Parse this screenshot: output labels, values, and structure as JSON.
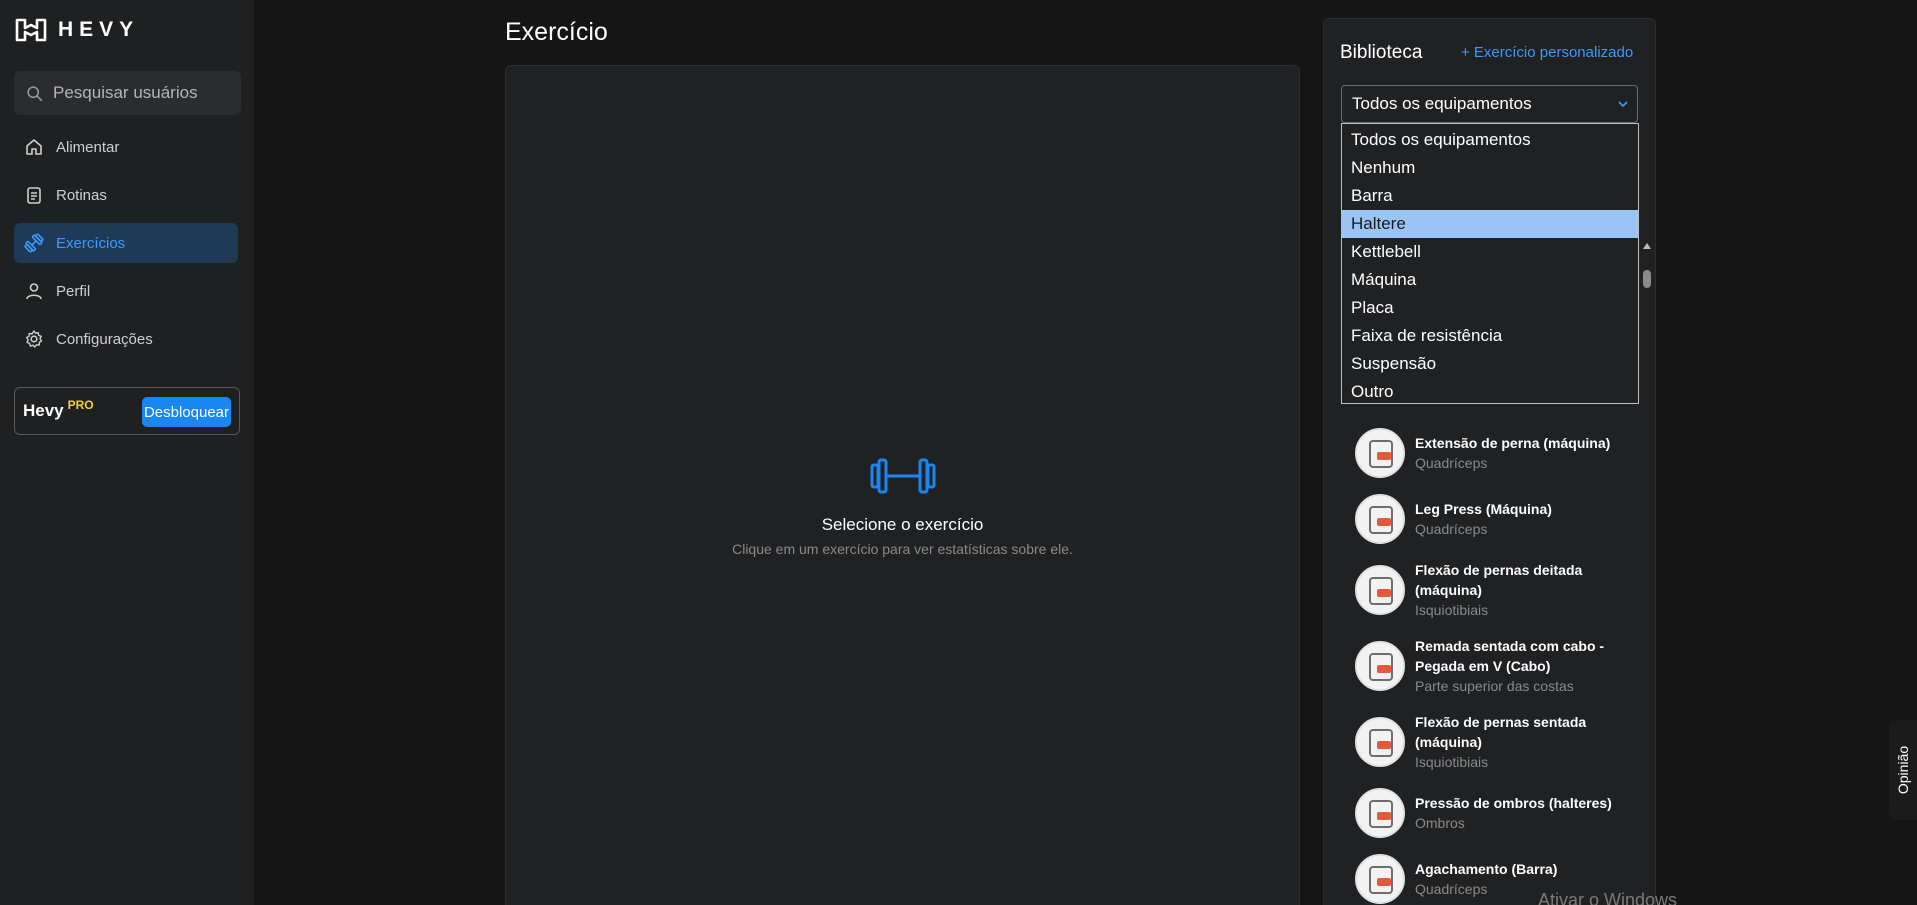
{
  "app": {
    "logo_text": "HEVY"
  },
  "search": {
    "placeholder": "Pesquisar usuários"
  },
  "nav": [
    {
      "label": "Alimentar",
      "icon": "home-icon"
    },
    {
      "label": "Rotinas",
      "icon": "clipboard-icon"
    },
    {
      "label": "Exercícios",
      "icon": "dumbbell-icon",
      "active": true
    },
    {
      "label": "Perfil",
      "icon": "user-icon"
    },
    {
      "label": "Configurações",
      "icon": "gear-icon"
    }
  ],
  "pro": {
    "brand": "Hevy",
    "tag": "PRO",
    "button": "Desbloquear"
  },
  "main": {
    "title": "Exercício",
    "empty_title": "Selecione o exercício",
    "empty_sub": "Clique em um exercício para ver estatísticas sobre ele."
  },
  "library": {
    "title": "Biblioteca",
    "custom_link": "+ Exercício personalizado",
    "select_value": "Todos os equipamentos",
    "options": [
      "Todos os equipamentos",
      "Nenhum",
      "Barra",
      "Haltere",
      "Kettlebell",
      "Máquina",
      "Placa",
      "Faixa de resistência",
      "Suspensão",
      "Outro"
    ],
    "selected_option": "Haltere",
    "exercises": [
      {
        "name": "Extensão de perna (máquina)",
        "muscle": "Quadríceps"
      },
      {
        "name": "Leg Press (Máquina)",
        "muscle": "Quadríceps"
      },
      {
        "name": "Flexão de pernas deitada (máquina)",
        "muscle": "Isquiotibiais"
      },
      {
        "name": "Remada sentada com cabo - Pegada em V (Cabo)",
        "muscle": "Parte superior das costas"
      },
      {
        "name": "Flexão de pernas sentada (máquina)",
        "muscle": "Isquiotibiais"
      },
      {
        "name": "Pressão de ombros (halteres)",
        "muscle": "Ombros"
      },
      {
        "name": "Agachamento (Barra)",
        "muscle": "Quadríceps"
      }
    ]
  },
  "overlay": {
    "watermark": "Ativar o Windows",
    "feedback": "Opinião"
  },
  "colors": {
    "accent": "#1a86f2",
    "active_bg": "#1e3a57",
    "pro": "#f6d32e",
    "selected_option": "#9cc3f5"
  }
}
